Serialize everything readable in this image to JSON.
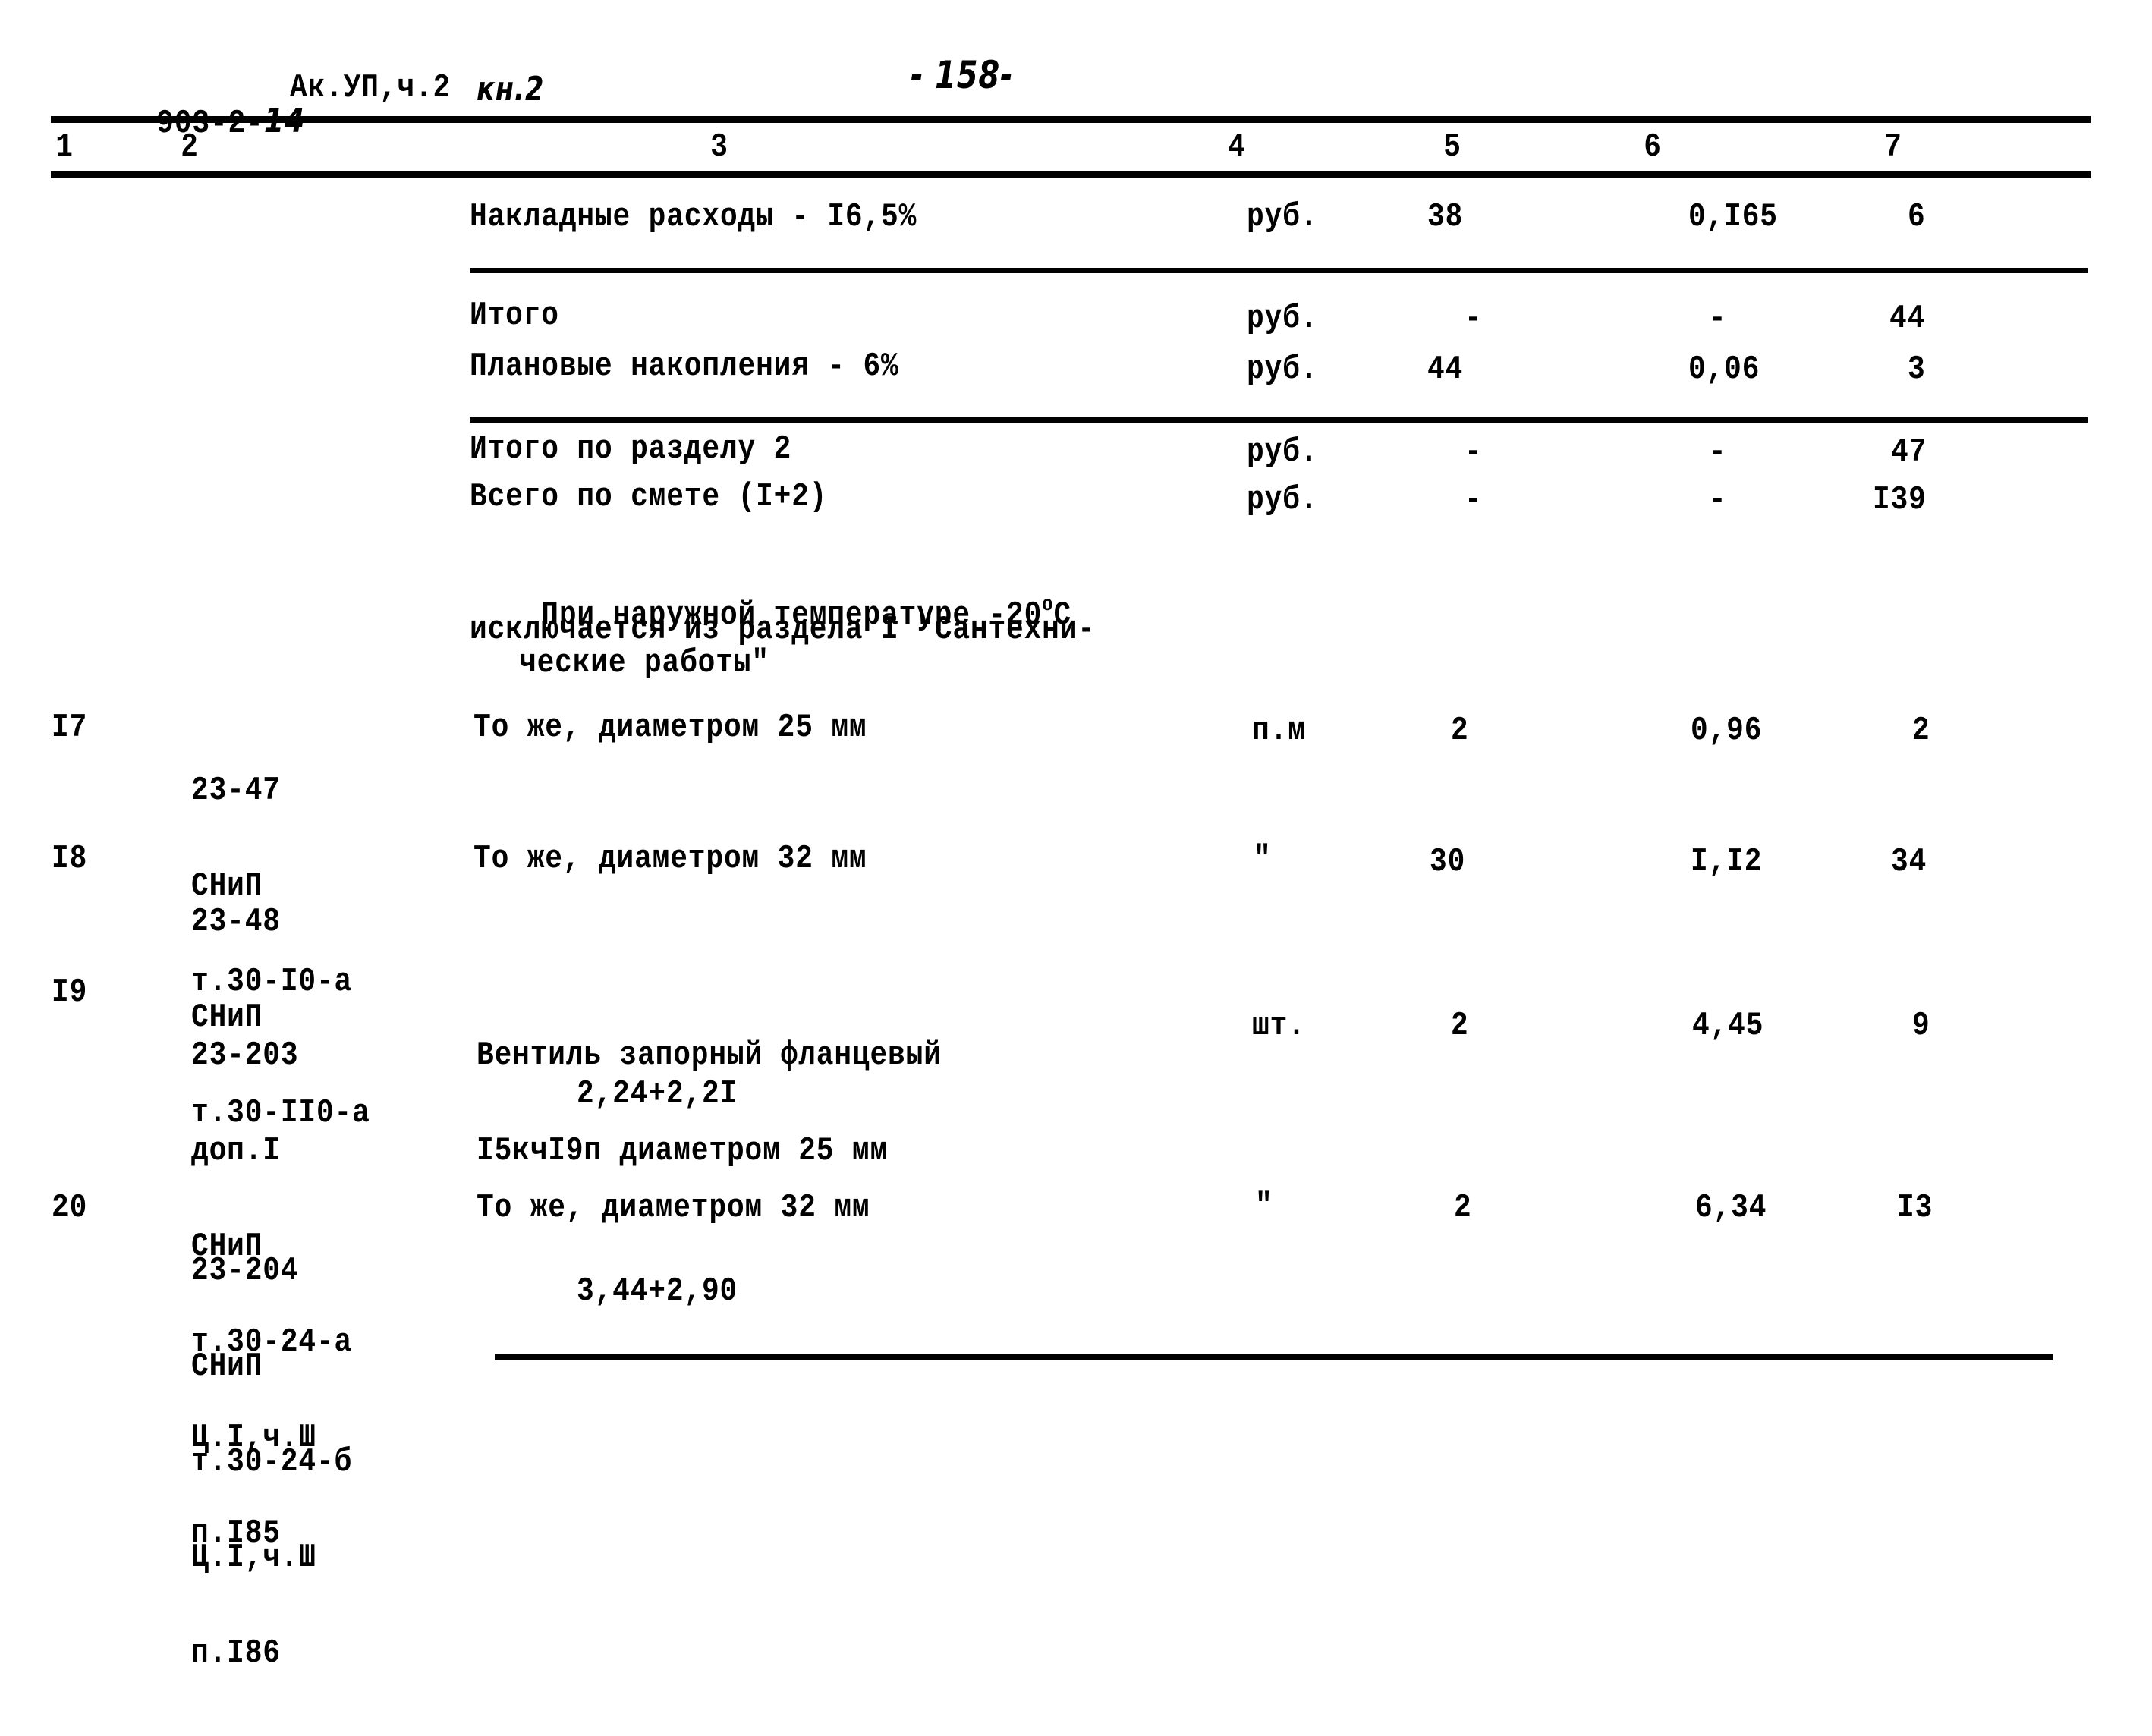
{
  "header": {
    "doc_code": "903-2-",
    "doc_code_hand": "14",
    "album": "Ак.УП,ч.2",
    "book_hand": "кн.2",
    "page_number": "- 158-"
  },
  "columns": [
    "1",
    "2",
    "3",
    "4",
    "5",
    "6",
    "7"
  ],
  "summary_rows": [
    {
      "name": "Накладные расходы - I6,5%",
      "unit": "руб.",
      "qty": "38",
      "price": "0,I65",
      "total": "6"
    },
    {
      "name": "Итого",
      "unit": "руб.",
      "qty": "-",
      "price": "-",
      "total": "44"
    },
    {
      "name": "Плановые накопления - 6%",
      "unit": "руб.",
      "qty": "44",
      "price": "0,06",
      "total": "3"
    },
    {
      "name": "Итого по разделу 2",
      "unit": "руб.",
      "qty": "-",
      "price": "-",
      "total": "47"
    },
    {
      "name": "Всего по смете (I+2)",
      "unit": "руб.",
      "qty": "-",
      "price": "-",
      "total": "I39"
    }
  ],
  "note": {
    "line1_prefix": "При наружной температуре -20",
    "line1_sup": "о",
    "line1_suffix": "С",
    "line2": "исключается из раздела I \"Сантехни-",
    "line3": "ческие работы\""
  },
  "items": [
    {
      "num": "I7",
      "code": [
        "23-47",
        "СНиП",
        "т.30-I0-а"
      ],
      "name": [
        "То же, диаметром 25 мм"
      ],
      "calc": "",
      "unit": "п.м",
      "qty": "2",
      "price": "0,96",
      "total": "2"
    },
    {
      "num": "I8",
      "code": [
        "23-48",
        "СНиП",
        "т.30-II0-а"
      ],
      "name": [
        "То же, диаметром 32 мм"
      ],
      "calc": "",
      "unit": "\"",
      "qty": "30",
      "price": "I,I2",
      "total": "34"
    },
    {
      "num": "I9",
      "code": [
        "23-203",
        "доп.I",
        "СНиП",
        "т.30-24-а",
        "Ц.I,ч.Ш",
        "п.I85"
      ],
      "name": [
        "Вентиль запорный фланцевый",
        "I5кчI9п диаметром 25 мм"
      ],
      "calc": "2,24+2,2I",
      "unit": "шт.",
      "qty": "2",
      "price": "4,45",
      "total": "9"
    },
    {
      "num": "20",
      "code": [
        "23-204",
        "СНиП",
        "т.30-24-б",
        "Ц.I,ч.Ш",
        "п.I86"
      ],
      "name": [
        "То же, диаметром 32 мм"
      ],
      "calc": "3,44+2,90",
      "unit": "\"",
      "qty": "2",
      "price": "6,34",
      "total": "I3"
    }
  ]
}
